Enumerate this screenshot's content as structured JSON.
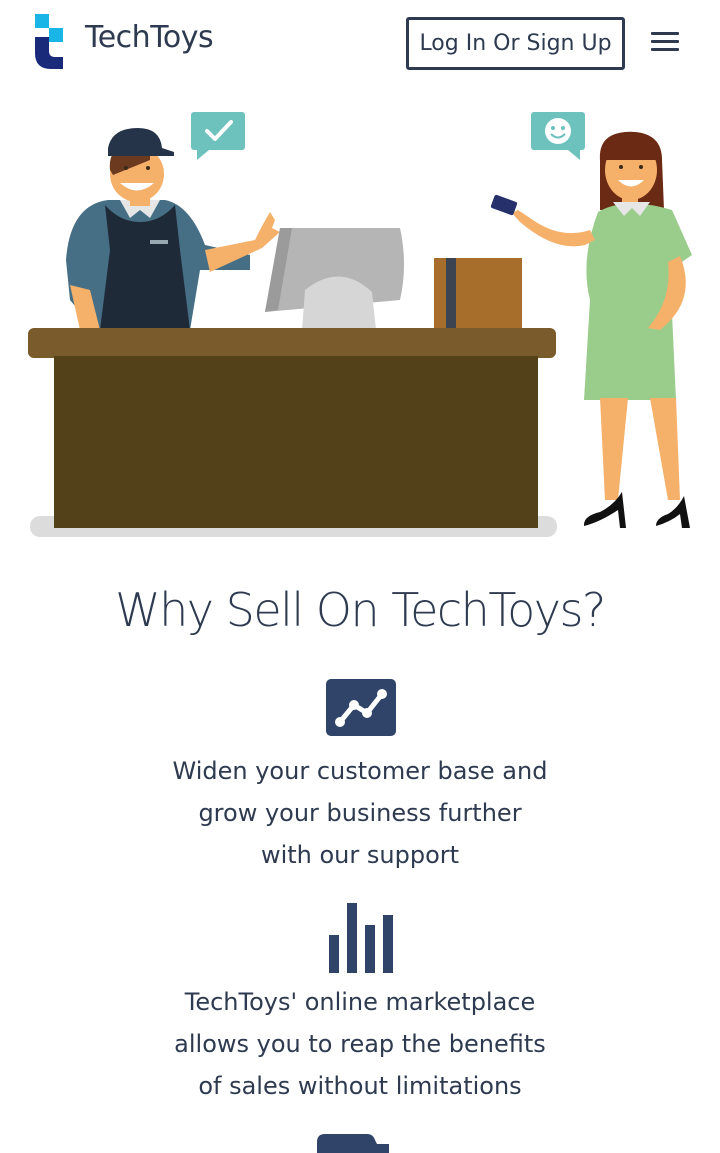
{
  "header": {
    "brand": "TechToys",
    "login_label": "Log In Or Sign Up",
    "logo_icon": "techtoys-logo-icon",
    "menu_icon": "hamburger-menu-icon"
  },
  "hero": {
    "illustration": "cashier-and-customer-illustration"
  },
  "section": {
    "title": "Why Sell On TechToys?"
  },
  "features": [
    {
      "icon": "trend-chart-icon",
      "text": "Widen your customer base and\ngrow your business further\nwith our support"
    },
    {
      "icon": "bar-chart-icon",
      "text": "TechToys' online marketplace\nallows you to reap the benefits\nof sales without limitations"
    },
    {
      "icon": "folder-icon",
      "text": ""
    }
  ],
  "colors": {
    "primary": "#2e3a4f",
    "icon_bg": "#2f4468",
    "logo_cyan": "#19b5e6",
    "logo_navy": "#1a2a7a"
  }
}
